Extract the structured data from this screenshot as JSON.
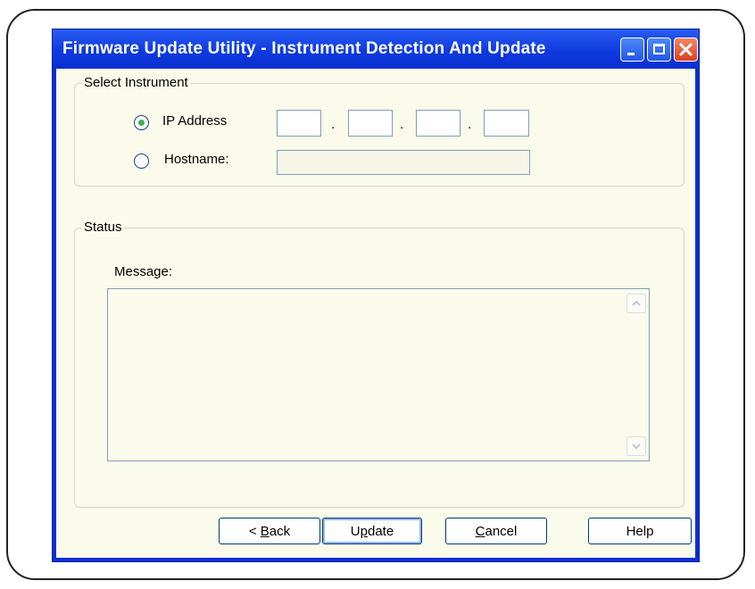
{
  "window": {
    "title": "Firmware Update Utility - Instrument Detection And Update"
  },
  "titlebar_buttons": {
    "minimize_icon": "minimize-icon",
    "maximize_icon": "maximize-icon",
    "close_icon": "close-icon"
  },
  "select_instrument": {
    "group_label": "Select Instrument",
    "ip_address_label": "IP Address",
    "ip_selected": true,
    "ip_octets": [
      "",
      "",
      "",
      ""
    ],
    "ip_separator": ".",
    "hostname_label": "Hostname:",
    "hostname_value": ""
  },
  "status": {
    "group_label": "Status",
    "message_label": "Message:",
    "message_value": ""
  },
  "buttons": {
    "back_prefix": "< ",
    "back_mnemonic": "B",
    "back_rest": "ack",
    "update_prefix": "U",
    "update_mnemonic": "p",
    "update_rest": "date",
    "cancel_mnemonic": "C",
    "cancel_rest": "ancel",
    "help": "Help"
  },
  "colors": {
    "titlebar": "#0a2fd9",
    "client_bg": "#fbfbeb",
    "radio_dot": "#3bb24a"
  }
}
